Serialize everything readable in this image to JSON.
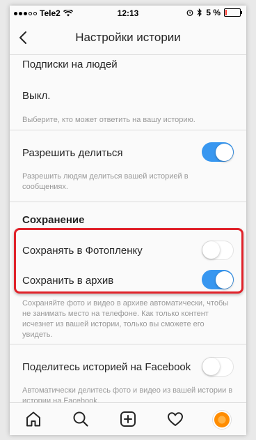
{
  "status": {
    "carrier": "Tele2",
    "time": "12:13",
    "battery": "5 %"
  },
  "header": {
    "title": "Настройки истории"
  },
  "replies": {
    "title": "Подписки на людей",
    "value": "Выкл.",
    "hint": "Выберите, кто может ответить на вашу историю."
  },
  "sharing": {
    "label": "Разрешить делиться",
    "enabled": true,
    "hint": "Разрешить людям делиться вашей историей в сообщениях."
  },
  "saving": {
    "section_title": "Сохранение",
    "camera_roll_label": "Сохранять в Фотопленку",
    "camera_roll_enabled": false,
    "archive_label": "Сохранить в архив",
    "archive_enabled": true,
    "archive_hint": "Сохраняйте фото и видео в архиве автоматически, чтобы не занимать место на телефоне. Как только контент исчезнет из вашей истории, только вы сможете его увидеть."
  },
  "facebook": {
    "label": "Поделитесь историей на Facebook",
    "enabled": false,
    "hint": "Автоматически делитесь фото и видео из вашей истории в истории на Facebook."
  },
  "tabbar": {
    "items": [
      "home-icon",
      "search-icon",
      "add-post-icon",
      "heart-icon",
      "profile-avatar"
    ]
  },
  "colors": {
    "toggle_on": "#3897f0",
    "highlight": "#e0222a",
    "hint_text": "#999999"
  }
}
